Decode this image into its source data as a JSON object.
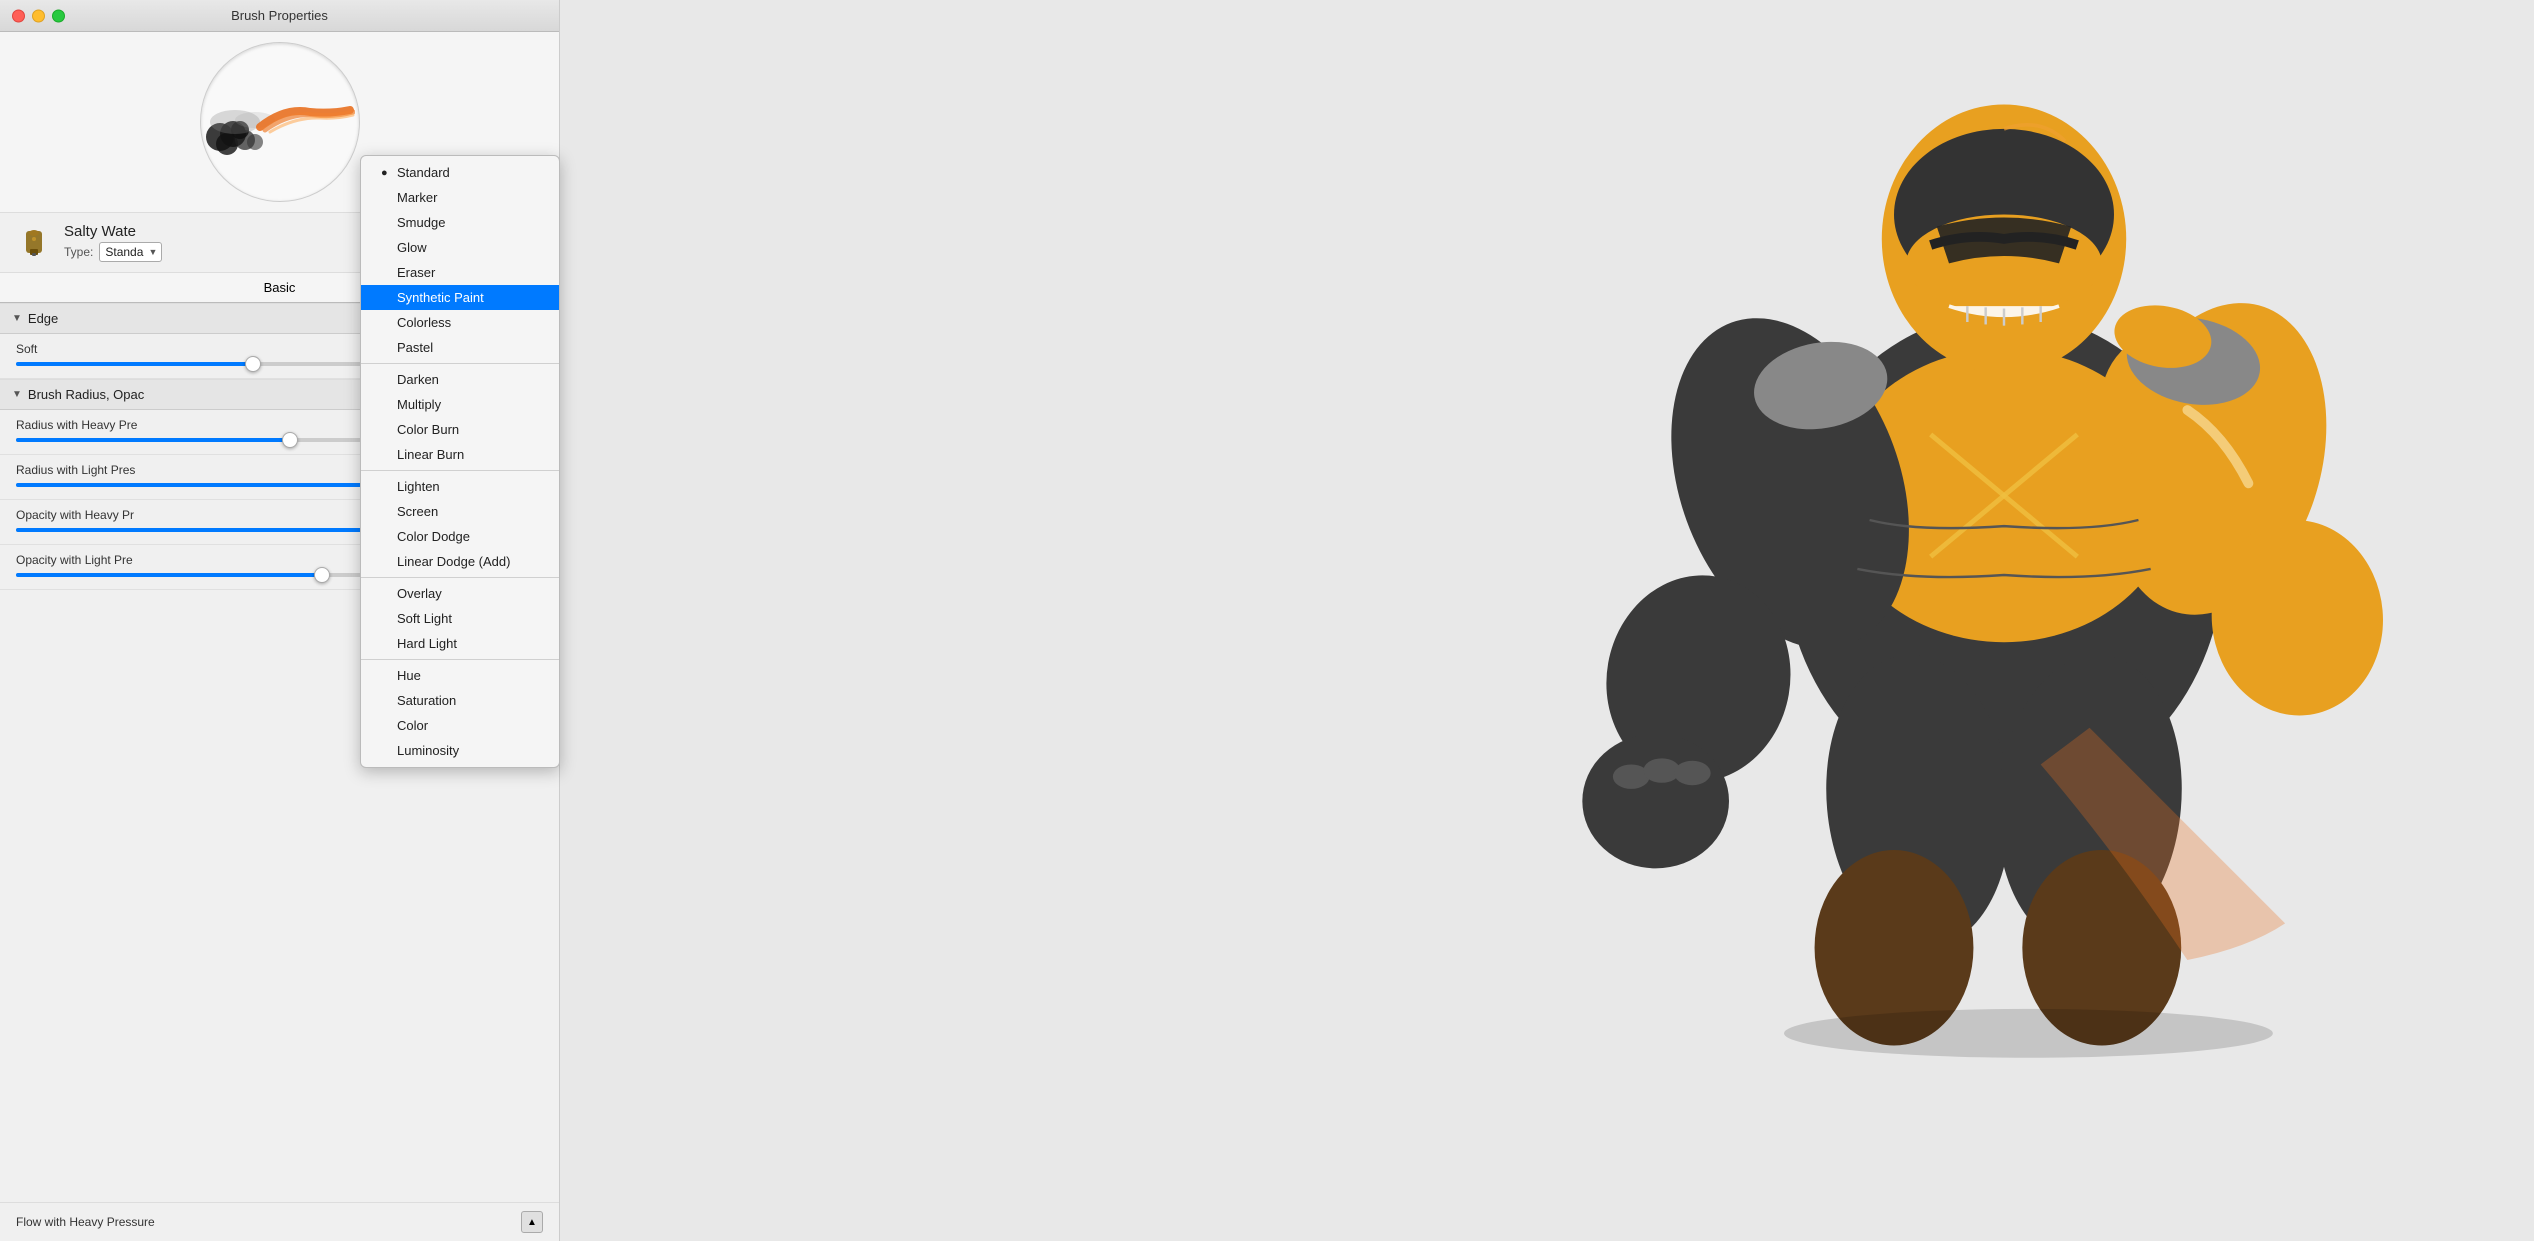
{
  "window": {
    "title": "Brush Properties"
  },
  "tabs": [
    {
      "id": "basic",
      "label": "Basic",
      "active": true
    }
  ],
  "brush": {
    "name": "Salty Wate",
    "type_label": "Type:",
    "type_value": "Standa",
    "icon_label": "brush-icon"
  },
  "sections": {
    "edge": {
      "label": "Edge",
      "expanded": true,
      "sliders": [
        {
          "id": "soft",
          "label": "Soft",
          "fill_pct": 45
        }
      ]
    },
    "brush_radius": {
      "label": "Brush Radius, Opac",
      "expanded": true,
      "sliders": [
        {
          "id": "radius_heavy",
          "label": "Radius with Heavy Pre",
          "fill_pct": 55
        },
        {
          "id": "radius_light",
          "label": "Radius with Light Pres",
          "fill_pct": 70
        },
        {
          "id": "opacity_heavy",
          "label": "Opacity with Heavy Pr",
          "fill_pct": 80
        },
        {
          "id": "opacity_light",
          "label": "Opacity with Light Pre",
          "fill_pct": 60
        }
      ]
    }
  },
  "bottom": {
    "label": "Flow with Heavy Pressure",
    "value": ""
  },
  "dropdown_menu": {
    "items": [
      {
        "id": "standard",
        "label": "Standard",
        "selected": false,
        "has_bullet": true,
        "separator_after": false
      },
      {
        "id": "marker",
        "label": "Marker",
        "selected": false,
        "has_bullet": false,
        "separator_after": false
      },
      {
        "id": "smudge",
        "label": "Smudge",
        "selected": false,
        "has_bullet": false,
        "separator_after": false
      },
      {
        "id": "glow",
        "label": "Glow",
        "selected": false,
        "has_bullet": false,
        "separator_after": false
      },
      {
        "id": "eraser",
        "label": "Eraser",
        "selected": false,
        "has_bullet": false,
        "separator_after": false
      },
      {
        "id": "synthetic_paint",
        "label": "Synthetic Paint",
        "selected": true,
        "has_bullet": false,
        "separator_after": false
      },
      {
        "id": "colorless",
        "label": "Colorless",
        "selected": false,
        "has_bullet": false,
        "separator_after": false
      },
      {
        "id": "pastel",
        "label": "Pastel",
        "selected": false,
        "has_bullet": false,
        "separator_after": true
      },
      {
        "id": "darken",
        "label": "Darken",
        "selected": false,
        "has_bullet": false,
        "separator_after": false
      },
      {
        "id": "multiply",
        "label": "Multiply",
        "selected": false,
        "has_bullet": false,
        "separator_after": false
      },
      {
        "id": "color_burn",
        "label": "Color Burn",
        "selected": false,
        "has_bullet": false,
        "separator_after": false
      },
      {
        "id": "linear_burn",
        "label": "Linear Burn",
        "selected": false,
        "has_bullet": false,
        "separator_after": true
      },
      {
        "id": "lighten",
        "label": "Lighten",
        "selected": false,
        "has_bullet": false,
        "separator_after": false
      },
      {
        "id": "screen",
        "label": "Screen",
        "selected": false,
        "has_bullet": false,
        "separator_after": false
      },
      {
        "id": "color_dodge",
        "label": "Color Dodge",
        "selected": false,
        "has_bullet": false,
        "separator_after": false
      },
      {
        "id": "linear_dodge",
        "label": "Linear Dodge (Add)",
        "selected": false,
        "has_bullet": false,
        "separator_after": true
      },
      {
        "id": "overlay",
        "label": "Overlay",
        "selected": false,
        "has_bullet": false,
        "separator_after": false
      },
      {
        "id": "soft_light",
        "label": "Soft Light",
        "selected": false,
        "has_bullet": false,
        "separator_after": false
      },
      {
        "id": "hard_light",
        "label": "Hard Light",
        "selected": false,
        "has_bullet": false,
        "separator_after": true
      },
      {
        "id": "hue",
        "label": "Hue",
        "selected": false,
        "has_bullet": false,
        "separator_after": false
      },
      {
        "id": "saturation",
        "label": "Saturation",
        "selected": false,
        "has_bullet": false,
        "separator_after": false
      },
      {
        "id": "color",
        "label": "Color",
        "selected": false,
        "has_bullet": false,
        "separator_after": false
      },
      {
        "id": "luminosity",
        "label": "Luminosity",
        "selected": false,
        "has_bullet": false,
        "separator_after": false
      }
    ]
  },
  "sliders_data": {
    "soft_thumb": 45,
    "radius_heavy_thumb": 52,
    "radius_light_thumb": 68,
    "opacity_heavy_thumb": 78,
    "opacity_light_thumb": 58
  }
}
